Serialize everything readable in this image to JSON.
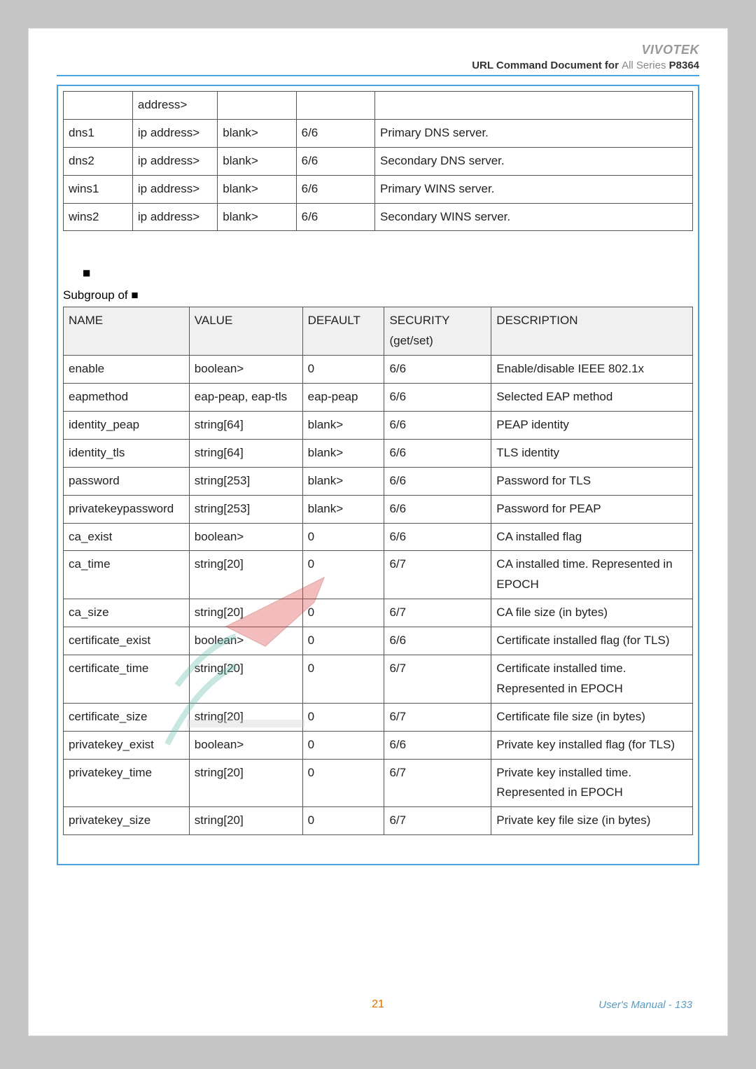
{
  "header": {
    "brand": "VIVOTEK",
    "doc_title_prefix": "URL Command Document for ",
    "doc_title_series": "All Series",
    "doc_title_model": "P8364"
  },
  "table1": {
    "rows": [
      {
        "name": "",
        "value": "address>",
        "default": "",
        "security": "",
        "description": ""
      },
      {
        "name": "dns1",
        "value": "ip address>",
        "default": "blank>",
        "security": "6/6",
        "description": "Primary DNS server."
      },
      {
        "name": "dns2",
        "value": "ip address>",
        "default": "blank>",
        "security": "6/6",
        "description": "Secondary DNS server."
      },
      {
        "name": "wins1",
        "value": "ip address>",
        "default": "blank>",
        "security": "6/6",
        "description": "Primary WINS server."
      },
      {
        "name": "wins2",
        "value": "ip address>",
        "default": "blank>",
        "security": "6/6",
        "description": "Secondary WINS server."
      }
    ]
  },
  "section_number": "■",
  "subgroup_label": "Subgroup of ",
  "subgroup_icon": "■",
  "table2": {
    "headers": [
      "NAME",
      "VALUE",
      "DEFAULT",
      "SECURITY (get/set)",
      "DESCRIPTION"
    ],
    "rows": [
      {
        "name": "enable",
        "value": "boolean>",
        "default": "0",
        "security": "6/6",
        "description": "Enable/disable IEEE 802.1x"
      },
      {
        "name": "eapmethod",
        "value": "eap-peap, eap-tls",
        "default": "eap-peap",
        "security": "6/6",
        "description": "Selected EAP method"
      },
      {
        "name": "identity_peap",
        "value": "string[64]",
        "default": "blank>",
        "security": "6/6",
        "description": "PEAP identity"
      },
      {
        "name": "identity_tls",
        "value": "string[64]",
        "default": "blank>",
        "security": "6/6",
        "description": "TLS identity"
      },
      {
        "name": "password",
        "value": "string[253]",
        "default": "blank>",
        "security": "6/6",
        "description": "Password for TLS"
      },
      {
        "name": "privatekeypassword",
        "value": "string[253]",
        "default": "blank>",
        "security": "6/6",
        "description": "Password for PEAP"
      },
      {
        "name": "ca_exist",
        "value": "boolean>",
        "default": "0",
        "security": "6/6",
        "description": "CA installed flag"
      },
      {
        "name": "ca_time",
        "value": "string[20]",
        "default": "0",
        "security": "6/7",
        "description": "CA installed time. Represented in EPOCH"
      },
      {
        "name": "ca_size",
        "value": "string[20]",
        "default": "0",
        "security": "6/7",
        "description": "CA file size (in bytes)"
      },
      {
        "name": "certificate_exist",
        "value": "boolean>",
        "default": "0",
        "security": "6/6",
        "description": "Certificate installed flag (for TLS)"
      },
      {
        "name": "certificate_time",
        "value": "string[20]",
        "default": "0",
        "security": "6/7",
        "description": "Certificate installed time. Represented in EPOCH"
      },
      {
        "name": "certificate_size",
        "value": "string[20]",
        "default": "0",
        "security": "6/7",
        "description": "Certificate file size (in bytes)"
      },
      {
        "name": "privatekey_exist",
        "value": "boolean>",
        "default": "0",
        "security": "6/6",
        "description": "Private key installed flag (for TLS)"
      },
      {
        "name": "privatekey_time",
        "value": "string[20]",
        "default": "0",
        "security": "6/7",
        "description": "Private key installed time. Represented in EPOCH"
      },
      {
        "name": "privatekey_size",
        "value": "string[20]",
        "default": "0",
        "security": "6/7",
        "description": "Private key file size (in bytes)"
      }
    ]
  },
  "page_number_center": "21",
  "footer_right": "User's Manual - 133"
}
